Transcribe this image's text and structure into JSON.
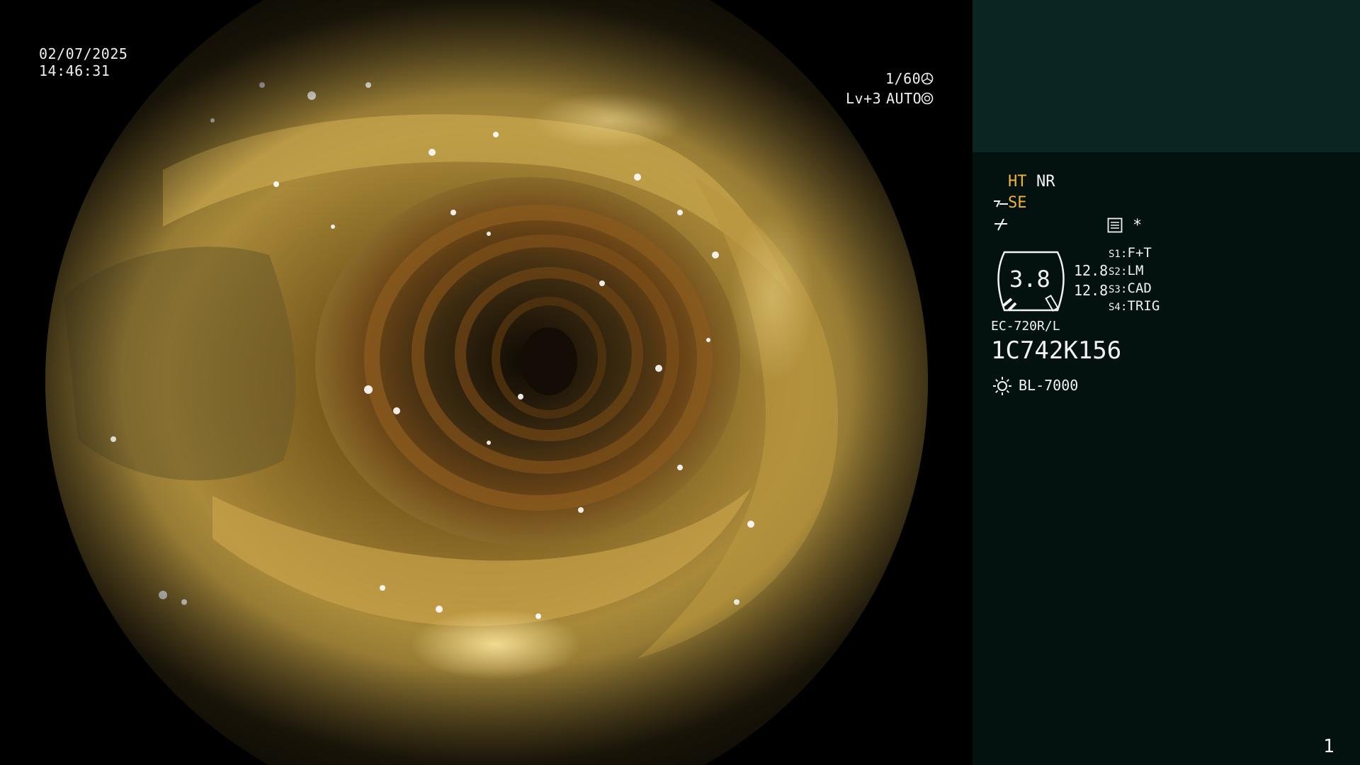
{
  "overlay": {
    "date": "02/07/2025",
    "time": "14:46:31",
    "shutter": "1/60",
    "level": "Lv+3",
    "iris_mode": "AUTO"
  },
  "panel": {
    "ht_label": "HT",
    "nr_label": "NR",
    "se_label": "SE",
    "star_label": "*",
    "scope_value": "3.8",
    "value_top": "12.8",
    "value_bottom": "12.8",
    "switches": [
      {
        "key": "S1",
        "value": "F+T"
      },
      {
        "key": "S2",
        "value": "LM"
      },
      {
        "key": "S3",
        "value": "CAD"
      },
      {
        "key": "S4",
        "value": "TRIG"
      }
    ],
    "scope_model": "EC-720R/L",
    "serial": "1C742K156",
    "light_source": "BL-7000",
    "page_number": "1"
  },
  "colors": {
    "panel_bg": "#03110f",
    "panel_header_bg": "#0b2622",
    "accent_yellow": "#f0b43a",
    "text": "#f2f2f2"
  },
  "icons": [
    "shutter-icon",
    "iris-icon",
    "se-mode-icon",
    "enhance-icon",
    "image-mode-icon",
    "scope-gauge-icon",
    "light-source-icon"
  ]
}
